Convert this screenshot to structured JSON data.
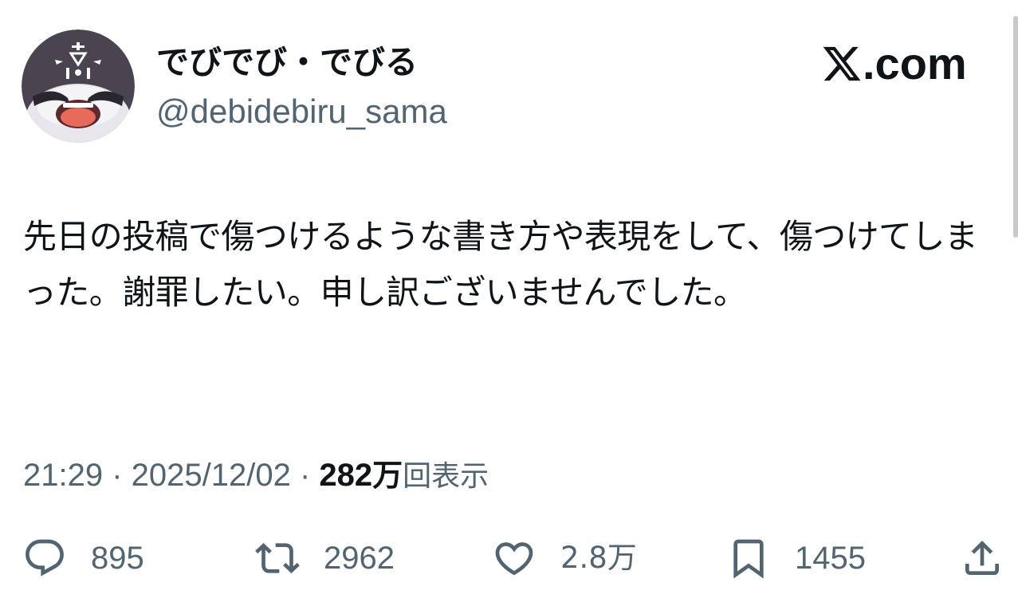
{
  "user": {
    "display_name": "でびでび・でびる",
    "handle": "@debidebiru_sama",
    "avatar_icon": "avatar-demon-mascot"
  },
  "brand": {
    "domain": ".com",
    "logo_icon": "x-logo-icon"
  },
  "tweet": {
    "text": "先日の投稿で傷つけるような書き方や表現をして、傷つけてしまった。謝罪したい。申し訳ございませんでした。"
  },
  "meta": {
    "time": "21:29",
    "separator": " · ",
    "date": "2025/12/02",
    "views_count": "282",
    "views_unit": "万",
    "views_suffix": "回表示"
  },
  "actions": {
    "reply": {
      "icon": "reply-icon",
      "count": "895"
    },
    "retweet": {
      "icon": "retweet-icon",
      "count": "2962"
    },
    "like": {
      "icon": "heart-icon",
      "count": "2.8万"
    },
    "bookmark": {
      "icon": "bookmark-icon",
      "count": "1455"
    },
    "share": {
      "icon": "share-icon"
    }
  },
  "colors": {
    "text_primary": "#0f1419",
    "text_secondary": "#536471",
    "background": "#ffffff"
  }
}
